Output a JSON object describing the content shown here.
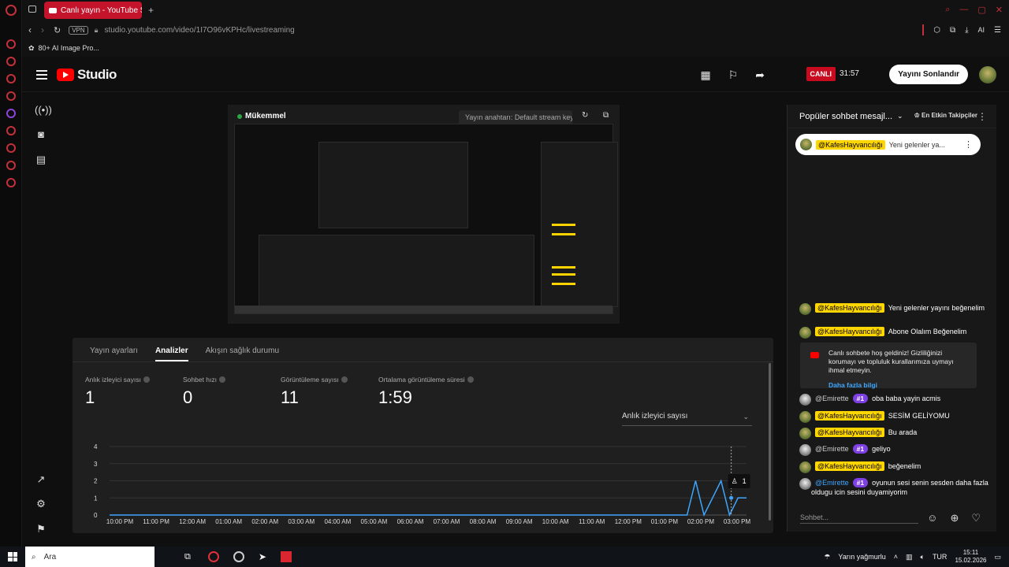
{
  "browser": {
    "tab_title": "Canlı yayın - YouTube Studio",
    "vpn": "VPN",
    "url": "studio.youtube.com/video/1I7O96vKPHc/livestreaming",
    "bookmark": "80+ AI Image Pro...",
    "ai_label": "AI"
  },
  "header": {
    "logo_text": "Studio",
    "live_badge": "CANLI",
    "live_time": "31:57",
    "end_button": "Yayını Sonlandır"
  },
  "preview": {
    "status": "Mükemmel",
    "stream_key": "Yayın anahtarı: Default stream key"
  },
  "analytics": {
    "tabs": [
      "Yayın ayarları",
      "Analizler",
      "Akışın sağlık durumu"
    ],
    "active_tab": 1,
    "stats": [
      {
        "label": "Anlık izleyici sayısı",
        "value": "1"
      },
      {
        "label": "Sohbet hızı",
        "value": "0"
      },
      {
        "label": "Görüntüleme sayısı",
        "value": "11"
      },
      {
        "label": "Ortalama görüntüleme süresi",
        "value": "1:59"
      }
    ],
    "metric_select": "Anlık izleyici sayısı",
    "tooltip_value": "1"
  },
  "chart_data": {
    "type": "line",
    "title": "",
    "xlabel": "",
    "ylabel": "",
    "x": [
      "10:00 PM",
      "11:00 PM",
      "12:00 AM",
      "01:00 AM",
      "02:00 AM",
      "03:00 AM",
      "04:00 AM",
      "05:00 AM",
      "06:00 AM",
      "07:00 AM",
      "08:00 AM",
      "09:00 AM",
      "10:00 AM",
      "11:00 AM",
      "12:00 PM",
      "01:00 PM",
      "02:00 PM",
      "03:00 PM"
    ],
    "yticks": [
      "0",
      "1",
      "2",
      "3",
      "4"
    ],
    "ylim": [
      0,
      4
    ],
    "grid": true,
    "series": [
      {
        "values": [
          0,
          0,
          0,
          0,
          0,
          0,
          0,
          0,
          0,
          0,
          0,
          0,
          0,
          0,
          0,
          0,
          0,
          0,
          0,
          0,
          0,
          0,
          0,
          0,
          0,
          0,
          0,
          0,
          0,
          0,
          0,
          0,
          0,
          0,
          0,
          0,
          0,
          0,
          0,
          0,
          0,
          0,
          0,
          0,
          0,
          0,
          0,
          0,
          0,
          0,
          0,
          0,
          0,
          0,
          0,
          0,
          0,
          0,
          0,
          0,
          0,
          0,
          0,
          0,
          0,
          0,
          0,
          0,
          0,
          2,
          0,
          1,
          2,
          0,
          1,
          1
        ],
        "color": "#3ea6ff"
      }
    ],
    "marker_x_fraction": 0.976
  },
  "chat": {
    "header": "Popüler sohbet mesajl...",
    "followers": "En Etkin Takipçiler",
    "pinned": {
      "user": "@KafesHayvancılığı",
      "text": "Yeni gelenler ya..."
    },
    "messages": [
      {
        "user": "@KafesHayvancılığı",
        "style": "yellow",
        "badge": "",
        "text": "Yeni gelenler yayını beğenelim"
      },
      {
        "user": "@KafesHayvancılığı",
        "style": "yellow",
        "badge": "",
        "text": "Abone Olalım Beğenelim"
      },
      {
        "user": "@Emirette",
        "style": "plain",
        "badge": "#1",
        "text": "oba baba yayin acmis"
      },
      {
        "user": "@KafesHayvancılığı",
        "style": "yellow",
        "badge": "",
        "text": "SESİM GELİYOMU"
      },
      {
        "user": "@KafesHayvancılığı",
        "style": "yellow",
        "badge": "",
        "text": "Bu arada"
      },
      {
        "user": "@Emirette",
        "style": "plain",
        "badge": "#1",
        "text": "geliyo"
      },
      {
        "user": "@KafesHayvancılığı",
        "style": "yellow",
        "badge": "",
        "text": "beğenelim"
      },
      {
        "user": "@Emirette",
        "style": "blue",
        "badge": "#1",
        "text": "oyunun sesi senin sesden daha fazla oldugu icin sesini duyamiyorim"
      }
    ],
    "notice": {
      "text": "Canlı sohbete hoş geldiniz! Gizliliğinizi korumayı ve topluluk kurallarımıza uymayı ihmal etmeyin.",
      "link": "Daha fazla bilgi"
    },
    "input_placeholder": "Sohbet..."
  },
  "taskbar": {
    "search": "Ara",
    "weather": "Yarın yağmurlu",
    "lang": "TUR",
    "time": "15:11",
    "date": "15.02.2026"
  }
}
